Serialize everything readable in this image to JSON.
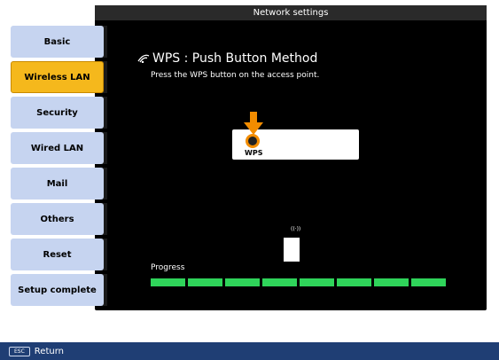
{
  "window": {
    "title": "Network settings"
  },
  "menu": {
    "items": [
      {
        "label": "Basic",
        "active": false
      },
      {
        "label": "Wireless LAN",
        "active": true
      },
      {
        "label": "Security",
        "active": false
      },
      {
        "label": "Wired LAN",
        "active": false
      },
      {
        "label": "Mail",
        "active": false
      },
      {
        "label": "Others",
        "active": false
      },
      {
        "label": "Reset",
        "active": false
      },
      {
        "label": "Setup complete",
        "active": false
      }
    ]
  },
  "content": {
    "heading": "WPS : Push Button Method",
    "heading_icon": "wifi-icon",
    "instruction": "Press the WPS button on the access point.",
    "wps_button_label": "WPS",
    "progress_label": "Progress",
    "progress_segments": 8,
    "progress_filled": 8
  },
  "footer": {
    "esc_key": "ESC",
    "return_label": "Return"
  },
  "colors": {
    "active_menu": "#f5b81c",
    "menu": "#c6d4f0",
    "progress": "#2fd45a",
    "footer_bg": "#1f3e74",
    "arrow": "#f28c00"
  }
}
